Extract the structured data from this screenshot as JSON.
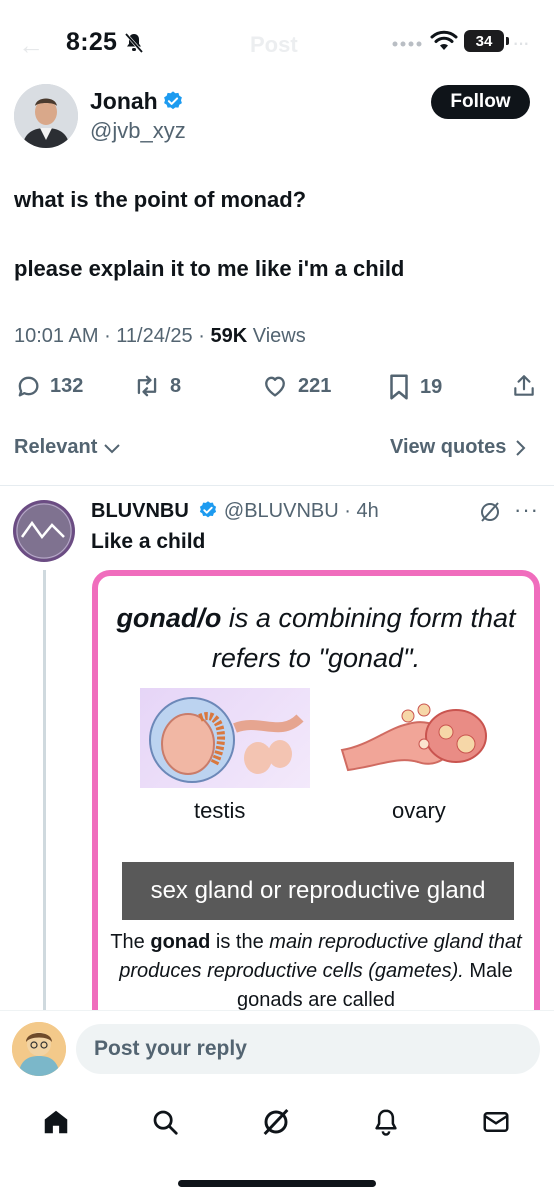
{
  "status_bar": {
    "time": "8:25",
    "battery": "34"
  },
  "nav": {
    "ghost_title": "Post"
  },
  "author": {
    "name": "Jonah",
    "handle": "@jvb_xyz",
    "follow_label": "Follow"
  },
  "tweet": {
    "line1": "what is the point of monad?",
    "line2": "please explain it to me like i'm a child",
    "time": "10:01 AM",
    "date": "11/24/25",
    "views_count": "59K",
    "views_label": "Views"
  },
  "actions": {
    "replies": "132",
    "reposts": "8",
    "likes": "221",
    "bookmarks": "19"
  },
  "filters": {
    "sort_label": "Relevant",
    "view_quotes_label": "View quotes"
  },
  "reply": {
    "name": "BLUVNBU",
    "handle": "@BLUVNBU",
    "age": "4h",
    "text": "Like a child",
    "media": {
      "title_term": "gonad/o",
      "title_rest": " is a combining form that refers to \"gonad\".",
      "label_left": "testis",
      "label_right": "ovary",
      "band": "sex gland or reproductive gland",
      "body_prefix": "The ",
      "body_term": "gonad",
      "body_mid": " is the ",
      "body_italic": "main reproductive gland that produces reproductive cells (gametes).",
      "body_tail": " Male gonads are called"
    }
  },
  "composer": {
    "placeholder": "Post your reply"
  },
  "colors": {
    "accent": "#1d9bf0",
    "card_border": "#f06dbd",
    "text": "#0f1419",
    "muted": "#536471"
  }
}
